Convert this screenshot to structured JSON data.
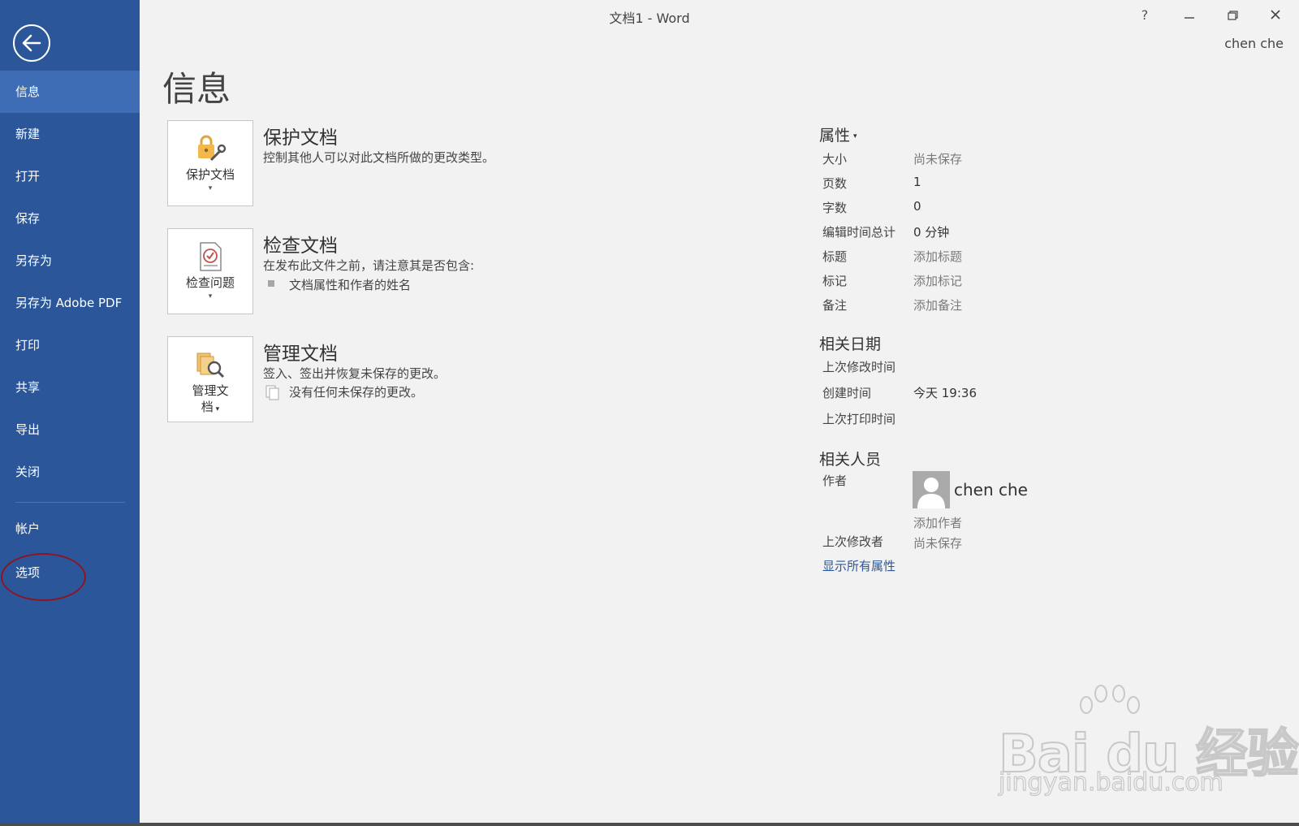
{
  "window": {
    "title": "文档1 - Word",
    "help_label": "?",
    "user": "chen che"
  },
  "sidebar": {
    "items": [
      {
        "label": "信息",
        "active": true
      },
      {
        "label": "新建"
      },
      {
        "label": "打开"
      },
      {
        "label": "保存"
      },
      {
        "label": "另存为"
      },
      {
        "label": "另存为 Adobe PDF"
      },
      {
        "label": "打印"
      },
      {
        "label": "共享"
      },
      {
        "label": "导出"
      },
      {
        "label": "关闭"
      }
    ],
    "bottom_items": [
      {
        "label": "帐户"
      },
      {
        "label": "选项",
        "annotated": true
      }
    ]
  },
  "main": {
    "title": "信息",
    "sections": {
      "protect": {
        "tile_label": "保护文档",
        "title": "保护文档",
        "description": "控制其他人可以对此文档所做的更改类型。"
      },
      "inspect": {
        "tile_label": "检查问题",
        "title": "检查文档",
        "description": "在发布此文件之前，请注意其是否包含:",
        "bullet": "文档属性和作者的姓名"
      },
      "manage": {
        "tile_label_line1": "管理文",
        "tile_label_line2": "档",
        "title": "管理文档",
        "description": "签入、签出并恢复未保存的更改。",
        "bullet": "没有任何未保存的更改。"
      }
    }
  },
  "properties": {
    "header": "属性",
    "rows": [
      {
        "label": "大小",
        "value": "尚未保存"
      },
      {
        "label": "页数",
        "value": "1"
      },
      {
        "label": "字数",
        "value": "0"
      },
      {
        "label": "编辑时间总计",
        "value": "0 分钟"
      },
      {
        "label": "标题",
        "value": "添加标题"
      },
      {
        "label": "标记",
        "value": "添加标记"
      },
      {
        "label": "备注",
        "value": "添加备注"
      }
    ],
    "dates": {
      "header": "相关日期",
      "rows": [
        {
          "label": "上次修改时间",
          "value": ""
        },
        {
          "label": "创建时间",
          "value": "今天 19:36"
        },
        {
          "label": "上次打印时间",
          "value": ""
        }
      ]
    },
    "people": {
      "header": "相关人员",
      "author_label": "作者",
      "author_name": "chen che",
      "add_author": "添加作者",
      "last_modified_label": "上次修改者",
      "last_modified_value": "尚未保存"
    },
    "show_all": "显示所有属性"
  },
  "watermark": {
    "brand": "Bai du 经验",
    "url": "jingyan.baidu.com"
  },
  "colors": {
    "sidebar": "#2b579a",
    "sidebar_active": "#3e6db5",
    "annotation_circle": "#8c1524",
    "link": "#2b579a"
  }
}
